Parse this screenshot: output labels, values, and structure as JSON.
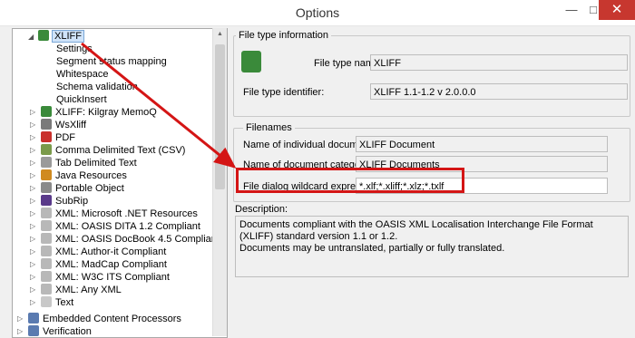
{
  "window": {
    "title": "Options",
    "min_icon": "minimize-icon",
    "max_icon": "maximize-icon",
    "close_icon": "close-icon"
  },
  "tree": {
    "selected": "XLIFF",
    "children": [
      "Settings",
      "Segment status mapping",
      "Whitespace",
      "Schema validation",
      "QuickInsert"
    ],
    "items": [
      "XLIFF: Kilgray MemoQ",
      "WsXliff",
      "PDF",
      "Comma Delimited Text (CSV)",
      "Tab Delimited Text",
      "Java Resources",
      "Portable Object",
      "SubRip",
      "XML: Microsoft .NET Resources",
      "XML: OASIS DITA 1.2 Compliant",
      "XML: OASIS DocBook 4.5 Compliant",
      "XML: Author-it Compliant",
      "XML: MadCap Compliant",
      "XML: W3C ITS Compliant",
      "XML: Any XML",
      "Text"
    ],
    "sections": [
      "Embedded Content Processors",
      "Verification"
    ]
  },
  "filetype": {
    "group_title": "File type information",
    "name_label": "File type name:",
    "name_value": "XLIFF",
    "id_label": "File type identifier:",
    "id_value": "XLIFF 1.1-1.2 v 2.0.0.0"
  },
  "filenames": {
    "group_title": "Filenames",
    "doc_label": "Name of individual document:",
    "doc_value": "XLIFF Document",
    "cat_label": "Name of document category:",
    "cat_value": "XLIFF Documents",
    "wild_label": "File dialog wildcard expression:",
    "wild_value": "*.xlf;*.xliff;*.xlz;*.txlf"
  },
  "description": {
    "label": "Description:",
    "line1": "Documents compliant with the OASIS XML Localisation Interchange File Format (XLIFF) standard version 1.1 or 1.2.",
    "line2": "Documents may be untranslated, partially or fully translated."
  },
  "colors": {
    "annotation": "#d41515"
  }
}
